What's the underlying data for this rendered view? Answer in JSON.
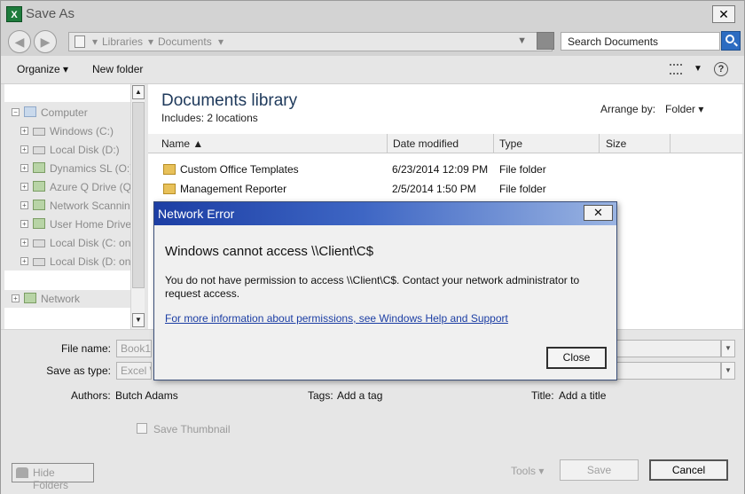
{
  "window": {
    "title": "Save As",
    "app_icon_text": "X",
    "close_glyph": "✕"
  },
  "address": {
    "breadcrumb": [
      "Libraries",
      "Documents"
    ],
    "search_value": "Search Documents"
  },
  "toolbar": {
    "organize_label": "Organize ▾",
    "new_folder_label": "New folder",
    "help_glyph": "?"
  },
  "nav": {
    "items": [
      {
        "label": "Computer",
        "icon": "computer-icon"
      },
      {
        "label": "Windows (C:)",
        "icon": "drive-icon"
      },
      {
        "label": "Local Disk (D:)",
        "icon": "disk-icon"
      },
      {
        "label": "Dynamics SL (O:)",
        "icon": "network-drive-icon"
      },
      {
        "label": "Azure Q Drive (Q:",
        "icon": "network-drive-icon"
      },
      {
        "label": "Network Scanning",
        "icon": "network-drive-icon"
      },
      {
        "label": "User Home Drive",
        "icon": "network-drive-icon"
      },
      {
        "label": "Local Disk (C: on",
        "icon": "disk-icon"
      },
      {
        "label": "Local Disk (D: on",
        "icon": "disk-icon"
      },
      {
        "label": "Network",
        "icon": "network-icon"
      }
    ]
  },
  "library": {
    "title": "Documents library",
    "includes_label": "Includes:",
    "includes_value": "2 locations",
    "arrange_label": "Arrange by:",
    "arrange_value": "Folder ▾"
  },
  "columns": {
    "name": "Name ▲",
    "date": "Date modified",
    "type": "Type",
    "size": "Size"
  },
  "files": [
    {
      "name": "Custom Office Templates",
      "date": "6/23/2014 12:09 PM",
      "type": "File folder"
    },
    {
      "name": "Management Reporter",
      "date": "2/5/2014 1:50 PM",
      "type": "File folder"
    }
  ],
  "form": {
    "file_name_label": "File name:",
    "file_name_value": "Book1.",
    "save_type_label": "Save as type:",
    "save_type_value": "Excel W",
    "authors_label": "Authors:",
    "authors_value": "Butch Adams",
    "tags_label": "Tags:",
    "tags_value": "Add a tag",
    "title_label": "Title:",
    "title_value": "Add a title",
    "thumbnail_label": "Save Thumbnail"
  },
  "footer": {
    "hide_folders": "Hide Folders",
    "tools": "Tools ▾",
    "save": "Save",
    "cancel": "Cancel"
  },
  "error_dialog": {
    "title": "Network Error",
    "heading": "Windows cannot access \\\\Client\\C$",
    "message": "You do not have permission to access \\\\Client\\C$. Contact your network administrator to request access.",
    "link": "For more information about permissions, see Windows Help and Support",
    "close_button": "Close",
    "close_glyph": "✕"
  }
}
